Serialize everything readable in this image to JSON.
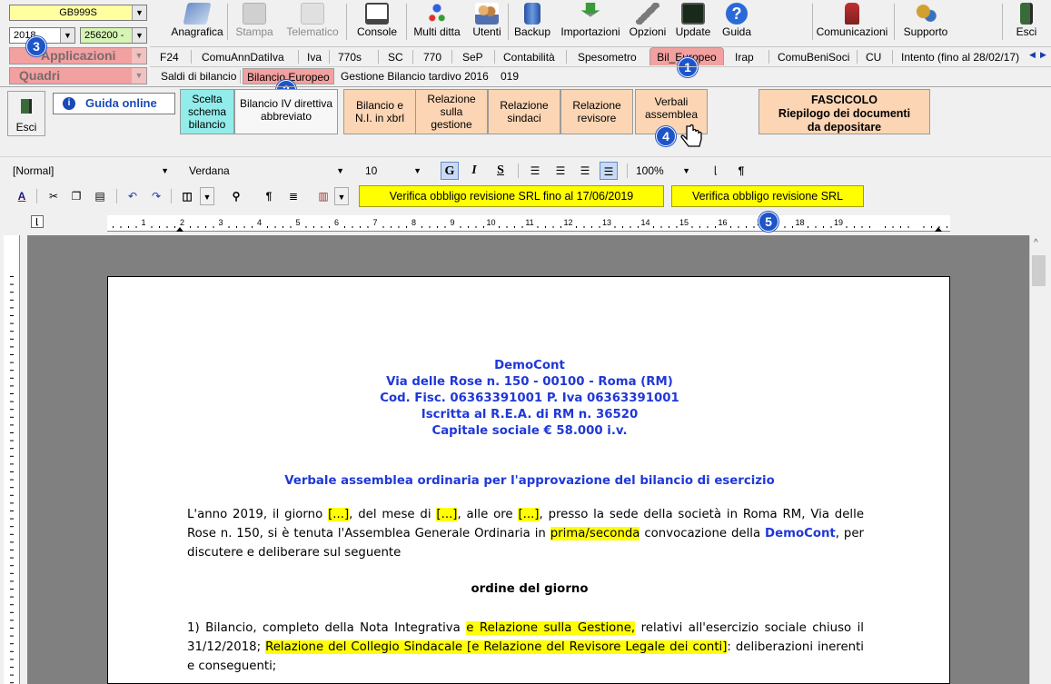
{
  "top_left": {
    "code_combo": "GB999S",
    "year_combo": "2018",
    "num_combo": "256200 -",
    "applicazioni_label": "Applicazioni",
    "quadri_label": "Quadri"
  },
  "toolbar": {
    "items": [
      {
        "label": "Anagrafica",
        "enabled": true
      },
      {
        "label": "Stampa",
        "enabled": false
      },
      {
        "label": "Telematico",
        "enabled": false
      },
      {
        "label": "Console",
        "enabled": true
      },
      {
        "label": "Multi ditta",
        "enabled": true
      },
      {
        "label": "Utenti",
        "enabled": true
      },
      {
        "label": "Backup",
        "enabled": true
      },
      {
        "label": "Importazioni",
        "enabled": true
      },
      {
        "label": "Opzioni",
        "enabled": true
      },
      {
        "label": "Update",
        "enabled": true
      },
      {
        "label": "Guida",
        "enabled": true
      }
    ],
    "comunicazioni": "Comunicazioni",
    "supporto": "Supporto",
    "esci": "Esci"
  },
  "tabs": [
    "F24",
    "ComuAnnDatiIva",
    "Iva",
    "770s",
    "SC",
    "770",
    "SeP",
    "Contabilità",
    "Spesometro",
    "Bil_Europeo",
    "Irap",
    "ComuBeniSoci",
    "CU",
    "Intento (fino al 28/02/17)"
  ],
  "active_tab": "Bil_Europeo",
  "subtabs": [
    "Saldi di bilancio",
    "Bilancio Europeo",
    "Gestione Bilancio tardivo 2016",
    "019"
  ],
  "active_subtab": "Bilancio Europeo",
  "section": {
    "esci": "Esci",
    "guida_online": "Guida online",
    "buttons": [
      "Scelta schema bilancio",
      "Bilancio IV direttiva abbreviato",
      "Bilancio e N.I. in xbrl",
      "Relazione sulla gestione",
      "Relazione sindaci",
      "Relazione revisore",
      "Verbali assemblea"
    ],
    "fascicolo_title": "FASCICOLO",
    "fascicolo_sub1": "Riepilogo dei documenti",
    "fascicolo_sub2": "da depositare"
  },
  "badges": [
    "1",
    "2",
    "3",
    "4",
    "5"
  ],
  "format_bar": {
    "style": "[Normal]",
    "font": "Verdana",
    "size": "10",
    "zoom": "100%"
  },
  "verify": {
    "btn1": "Verifica obbligo revisione SRL fino al 17/06/2019",
    "btn2": "Verifica obbligo revisione SRL"
  },
  "ruler_numbers": [
    "1",
    "2",
    "3",
    "4",
    "5",
    "6",
    "7",
    "8",
    "9",
    "10",
    "11",
    "12",
    "13",
    "14",
    "15",
    "16",
    "17",
    "18",
    "19"
  ],
  "document": {
    "company": "DemoCont",
    "address": "Via delle Rose n. 150 - 00100 - Roma (RM)",
    "tax": "Cod. Fisc. 06363391001 P. Iva 06363391001",
    "rea": "Iscritta al R.E.A. di RM n. 36520",
    "capital": "Capitale sociale € 58.000 i.v.",
    "title": "Verbale assemblea ordinaria per l'approvazione del bilancio di esercizio",
    "p1": [
      "L'anno 2019, il giorno ",
      "[...]",
      ", del mese di ",
      "[...]",
      ", alle ore ",
      "[...]",
      ", presso la sede della società in Roma RM, Via delle Rose n. 150, si è tenuta l'Assemblea Generale Ordinaria in ",
      "prima/seconda",
      " convocazione della ",
      "DemoCont",
      ", per discutere e deliberare sul seguente"
    ],
    "agenda": "ordine del giorno",
    "p2": [
      "1) Bilancio, completo della Nota Integrativa ",
      "e Relazione sulla Gestione,",
      " relativi all'esercizio sociale chiuso il 31/12/2018; ",
      "Relazione del Collegio Sindacale [e Relazione del Revisore Legale dei conti]",
      ": deliberazioni inerenti e conseguenti;"
    ]
  },
  "colors": {
    "blue_text": "#1f38d8",
    "highlight": "#ffff00",
    "peach": "#fcd5b4",
    "teal": "#92ecea",
    "badge": "#1d54c9",
    "active_tab": "#f2a0a0"
  }
}
